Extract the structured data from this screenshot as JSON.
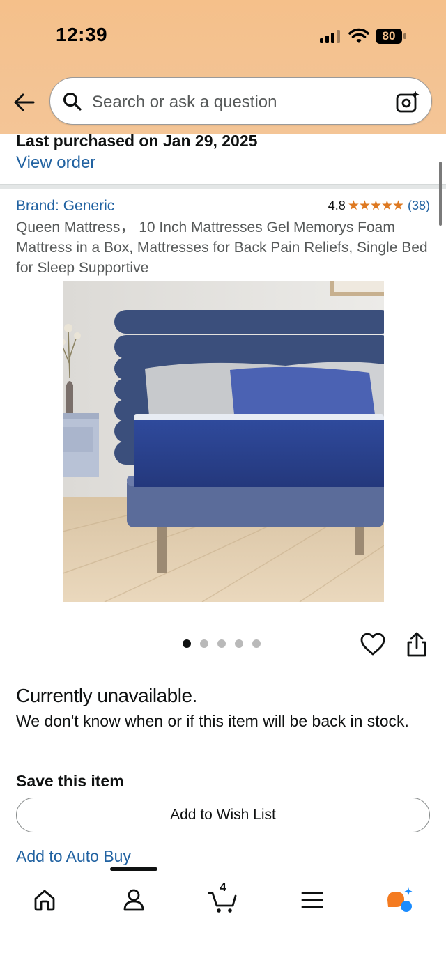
{
  "status_bar": {
    "time": "12:39",
    "battery": "80"
  },
  "search": {
    "placeholder": "Search or ask a question"
  },
  "purchase": {
    "last_purchased": "Last purchased on Jan 29, 2025",
    "view_order": "View order"
  },
  "product": {
    "brand": "Brand: Generic",
    "rating": "4.8",
    "stars": "★★★★★",
    "rating_count": "(38)",
    "title": "Queen Mattress， 10 Inch Mattresses Gel Memorys Foam Mattress in a Box, Mattresses for Back Pain Reliefs, Single Bed for Sleep Supportive",
    "image_count": 5,
    "active_image": 1
  },
  "availability": {
    "status": "Currently unavailable.",
    "note": "We don't know when or if this item will be back in stock."
  },
  "save": {
    "title": "Save this item",
    "wishlist_button": "Add to Wish List",
    "auto_buy": "Add to Auto Buy"
  },
  "bottom_nav": {
    "cart_count": "4"
  },
  "colors": {
    "link": "#2162a1",
    "star": "#de7921",
    "header": "#f4c08b",
    "rufus_orange": "#f47b20",
    "rufus_blue": "#1a8cff"
  }
}
